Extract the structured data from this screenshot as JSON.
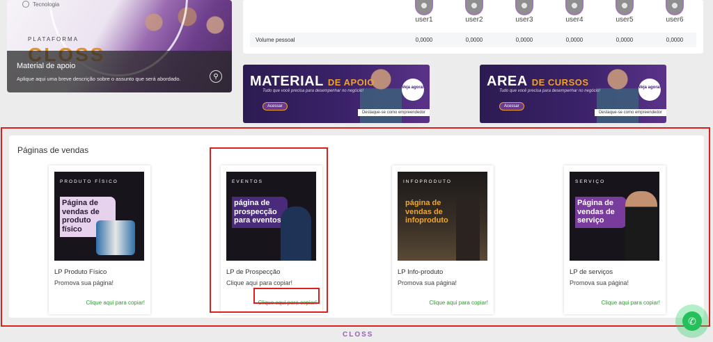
{
  "hero": {
    "tag": "Tecnologia",
    "platform": "PLATAFORMA",
    "logo": "CLOSS",
    "title": "Material de apoio",
    "description": "Aplique aqui uma breve descrição sobre o assunto que será abordado."
  },
  "users": {
    "names": [
      "user1",
      "user2",
      "user3",
      "user4",
      "user5",
      "user6"
    ],
    "volume_label": "Volume pessoal",
    "volume_values": [
      "0,0000",
      "0,0000",
      "0,0000",
      "0,0000",
      "0,0000",
      "0,0000"
    ]
  },
  "promos": [
    {
      "big": "MATERIAL",
      "big_suffix": "DE APOIO",
      "sub": "Tudo que você precisa para desempenhar no negócio!",
      "button": "Acessar",
      "veja": "Veja agora!",
      "strip": "Destaque-se como empreendedor"
    },
    {
      "big": "AREA",
      "big_suffix": "DE CURSOS",
      "sub": "Tudo que você precisa para desempenhar no negócio!",
      "button": "Acessar",
      "veja": "Veja agora!",
      "strip": "Destaque-se como empreendedor"
    }
  ],
  "sales": {
    "title": "Páginas de vendas",
    "cards": [
      {
        "category": "PRODUTO FÍSICO",
        "image_title": "Página de vendas de produto físico",
        "name": "LP Produto Físico",
        "promo": "Promova sua página!",
        "copy": "Clique aqui para copiar!",
        "title_bg": "#e6d2ec",
        "title_fg": "#2a1a33"
      },
      {
        "category": "EVENTOS",
        "image_title": "página de prospecção para eventos",
        "name": "LP de Prospecção",
        "promo": "Clique aqui para copiar!",
        "copy": "Clique aqui para copiar!",
        "title_bg": "#4a2a7a",
        "title_fg": "#ffffff"
      },
      {
        "category": "INFOPRODUTO",
        "image_title": "página de vendas de infoproduto",
        "name": "LP Info-produto",
        "promo": "Promova sua página!",
        "copy": "Clique aqui para copiar!",
        "title_bg": "transparent",
        "title_fg": "#f0a62b"
      },
      {
        "category": "SERVIÇO",
        "image_title": "Página de vendas de serviço",
        "name": "LP de serviços",
        "promo": "Promova sua página!",
        "copy": "Clique aqui para copiar!",
        "title_bg": "#7a3c9c",
        "title_fg": "#ffffff"
      }
    ]
  },
  "footer": {
    "logo": "CLOSS"
  },
  "colors": {
    "highlight": "#d9201f",
    "copy_link": "#2a9a2a",
    "whatsapp": "#25c05a",
    "brand_purple": "#3b2269",
    "brand_orange": "#f0a12b"
  },
  "icons": {
    "whatsapp": "whatsapp-icon",
    "zoom": "search-icon",
    "avatar": "user-avatar-icon"
  }
}
